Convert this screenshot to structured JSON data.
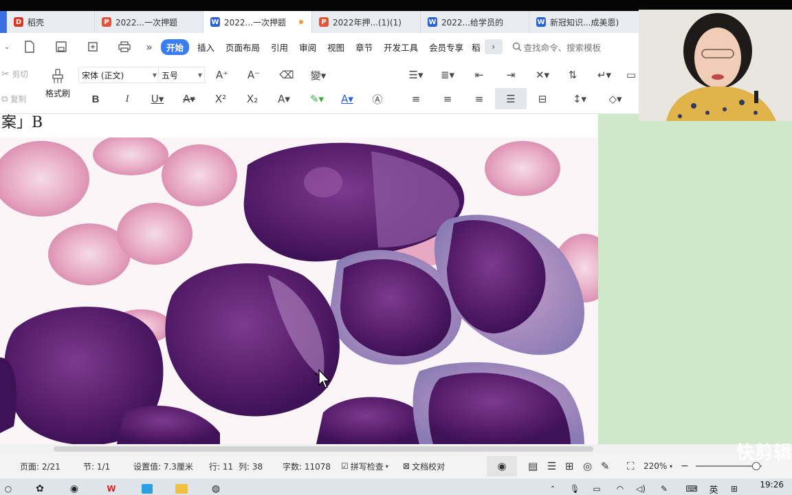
{
  "tabs": [
    {
      "label": "稻壳",
      "icon": "docer-icon"
    },
    {
      "label": "2022...一次押题",
      "icon": "ppt-icon"
    },
    {
      "label": "2022...一次押题",
      "icon": "word-icon",
      "active": true,
      "modified": true
    },
    {
      "label": "2022年押...(1)(1)",
      "icon": "ppt-icon"
    },
    {
      "label": "2022...给学员的",
      "icon": "word-icon"
    },
    {
      "label": "新冠知识...成美恩)",
      "icon": "word-icon"
    }
  ],
  "menu": {
    "start": "开始",
    "items": [
      "插入",
      "页面布局",
      "引用",
      "审阅",
      "视图",
      "章节",
      "开发工具",
      "会员专享",
      "稻"
    ],
    "search_placeholder": "查找命令、搜索模板"
  },
  "ribbon": {
    "cut": "剪切",
    "copy": "复制",
    "format_painter": "格式刷",
    "font_name": "宋体 (正文)",
    "font_size": "五号"
  },
  "document": {
    "top_text": "案」B"
  },
  "status": {
    "page": "页面: 2/21",
    "section": "节: 1/1",
    "setting": "设置值: 7.3厘米",
    "line": "行: 11",
    "column": "列: 38",
    "word_count": "字数: 11078",
    "spell_check": "拼写检查",
    "doc_proof": "文档校对",
    "zoom": "220%"
  },
  "watermark": "快剪辑",
  "clock": "19:26",
  "ime_label": "英",
  "colors": {
    "accent": "#3b7cf0",
    "page_background": "#cfe8c9",
    "cell_purple": "#5a1f6e"
  }
}
